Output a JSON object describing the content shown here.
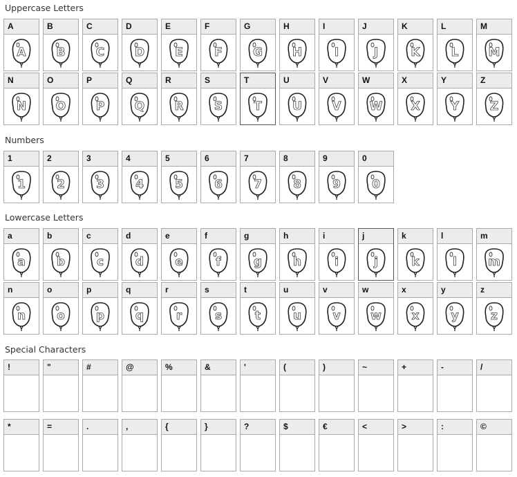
{
  "sections": {
    "uppercase": {
      "title": "Uppercase Letters",
      "row1": [
        "A",
        "B",
        "C",
        "D",
        "E",
        "F",
        "G",
        "H",
        "I",
        "J",
        "K",
        "L",
        "M"
      ],
      "row2": [
        "N",
        "O",
        "P",
        "Q",
        "R",
        "S",
        "T",
        "U",
        "V",
        "W",
        "X",
        "Y",
        "Z"
      ]
    },
    "numbers": {
      "title": "Numbers",
      "row1": [
        "1",
        "2",
        "3",
        "4",
        "5",
        "6",
        "7",
        "8",
        "9",
        "0"
      ]
    },
    "lowercase": {
      "title": "Lowercase Letters",
      "row1": [
        "a",
        "b",
        "c",
        "d",
        "e",
        "f",
        "g",
        "h",
        "i",
        "j",
        "k",
        "l",
        "m"
      ],
      "row2": [
        "n",
        "o",
        "p",
        "q",
        "r",
        "s",
        "t",
        "u",
        "v",
        "w",
        "x",
        "y",
        "z"
      ]
    },
    "special": {
      "title": "Special Characters",
      "row1": [
        "!",
        "\"",
        "#",
        "@",
        "%",
        "&",
        "'",
        "(",
        ")",
        "~",
        "+",
        "-",
        "/"
      ],
      "row2": [
        "*",
        "=",
        ".",
        ",",
        "{",
        "}",
        "?",
        "$",
        "€",
        "<",
        ">",
        ":",
        "©"
      ]
    }
  },
  "highlighted": [
    "T",
    "j"
  ],
  "glyph_style": "balloon-icon"
}
